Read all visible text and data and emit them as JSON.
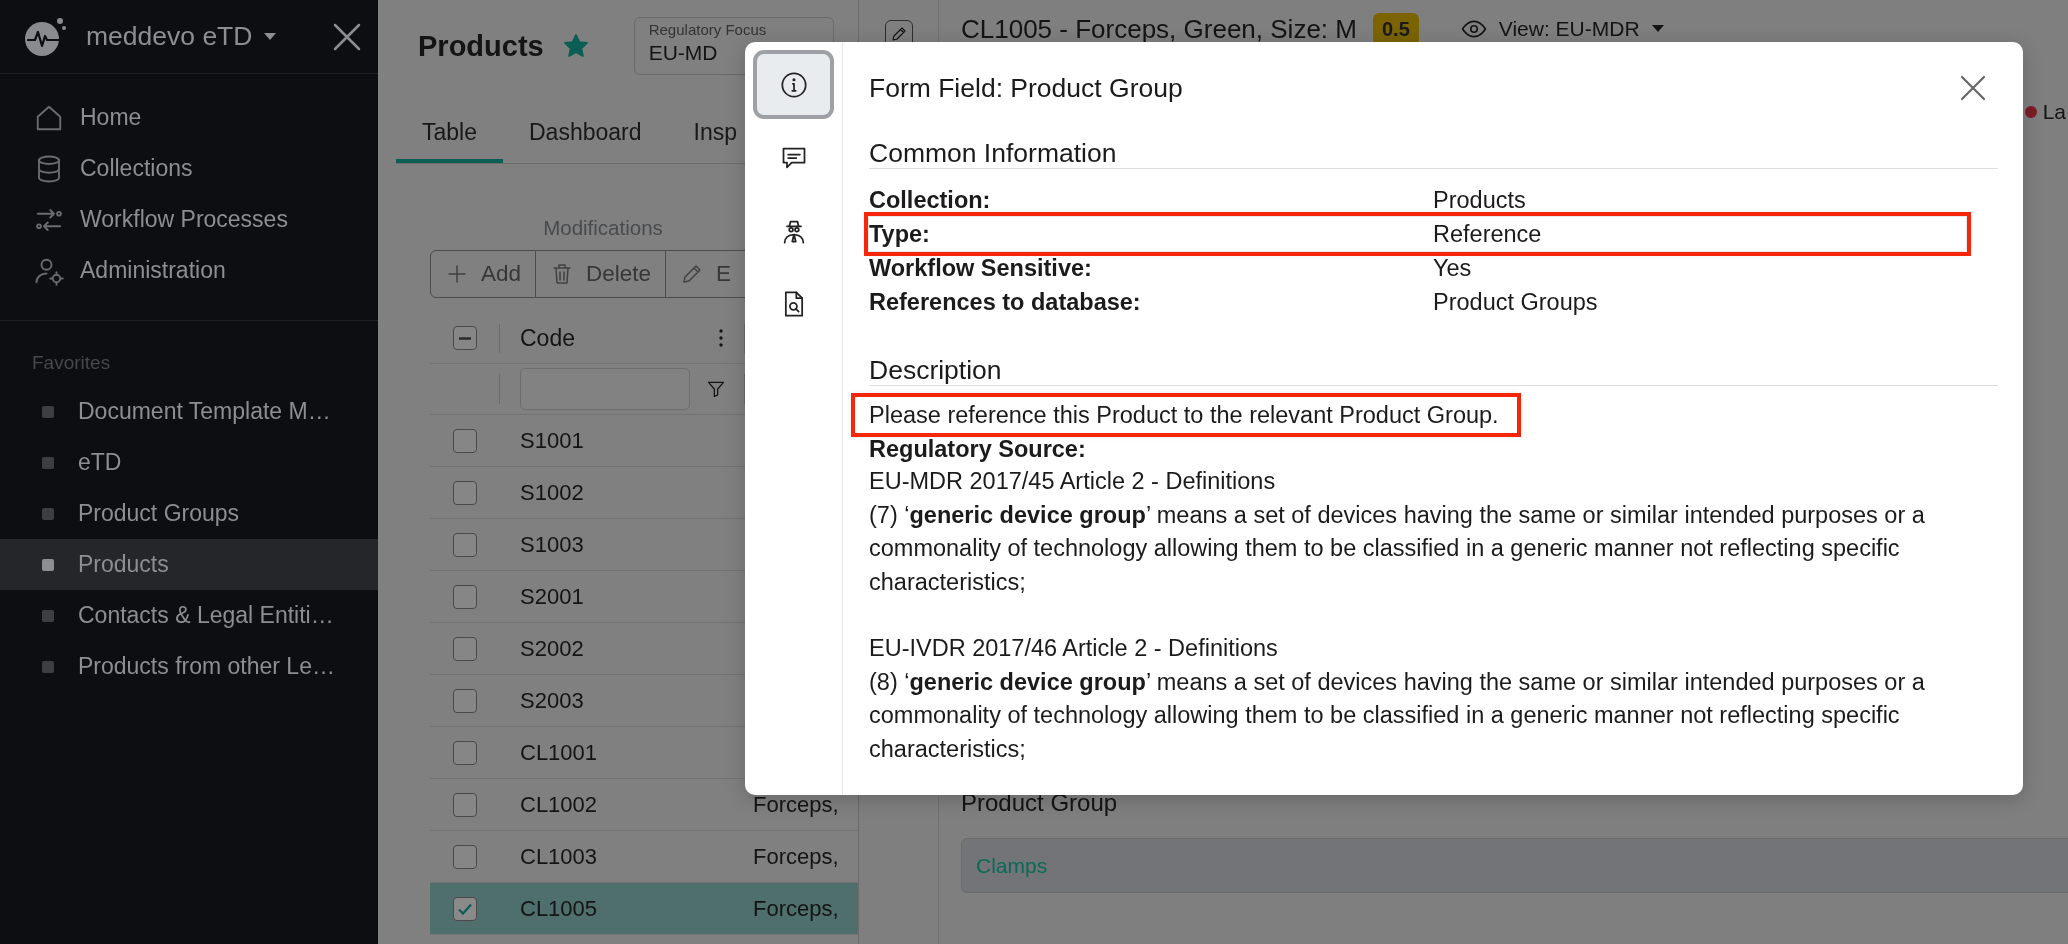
{
  "sidebar": {
    "brand": "meddevo eTD",
    "nav": [
      {
        "label": "Home"
      },
      {
        "label": "Collections"
      },
      {
        "label": "Workflow Processes"
      },
      {
        "label": "Administration"
      }
    ],
    "favorites_heading": "Favorites",
    "favorites": [
      {
        "label": "Document Template M…",
        "selected": false
      },
      {
        "label": "eTD",
        "selected": false
      },
      {
        "label": "Product Groups",
        "selected": false
      },
      {
        "label": "Products",
        "selected": true
      },
      {
        "label": "Contacts & Legal Entiti…",
        "selected": false
      },
      {
        "label": "Products from other Le…",
        "selected": false
      }
    ]
  },
  "page": {
    "title": "Products",
    "favorite": true,
    "focus_label": "Regulatory Focus",
    "focus_value": "EU-MD",
    "tabs": [
      {
        "label": "Table",
        "selected": true
      },
      {
        "label": "Dashboard",
        "selected": false
      },
      {
        "label": "Insp",
        "selected": false
      }
    ],
    "toolbar_label": "Modifications",
    "toolbar": [
      {
        "label": "Add"
      },
      {
        "label": "Delete"
      },
      {
        "label": "E"
      }
    ]
  },
  "table": {
    "select_all_partial": true,
    "columns": [
      "Code"
    ],
    "rows": [
      {
        "code": "S1001",
        "checked": false,
        "selected": false
      },
      {
        "code": "S1002",
        "checked": false,
        "selected": false
      },
      {
        "code": "S1003",
        "checked": false,
        "selected": false
      },
      {
        "code": "S2001",
        "checked": false,
        "selected": false
      },
      {
        "code": "S2002",
        "checked": false,
        "selected": false
      },
      {
        "code": "S2003",
        "checked": false,
        "selected": false
      },
      {
        "code": "CL1001",
        "checked": false,
        "selected": false
      },
      {
        "code": "CL1002",
        "column_2": "Forceps,",
        "checked": false,
        "selected": false
      },
      {
        "code": "CL1003",
        "column_2": "Forceps,",
        "checked": false,
        "selected": false
      },
      {
        "code": "CL1005",
        "column_2": "Forceps,",
        "checked": true,
        "selected": true
      }
    ]
  },
  "detail": {
    "title": "CL1005 - Forceps, Green, Size: M",
    "badge": "0.5",
    "view": "View: EU-MDR",
    "status": "La",
    "fields": [
      {
        "label": "Product Group",
        "value": "Clamps"
      }
    ]
  },
  "modal": {
    "rail": [
      {
        "selected": true
      },
      {
        "selected": false
      },
      {
        "selected": false
      },
      {
        "selected": false
      }
    ],
    "title": "Form Field: Product Group",
    "common_heading": "Common Information",
    "properties": [
      {
        "label": "Collection:",
        "value": "Products",
        "highlighted": false
      },
      {
        "label": "Type:",
        "value": "Reference",
        "highlighted": true
      },
      {
        "label": "Workflow Sensitive:",
        "value": "Yes",
        "highlighted": false
      },
      {
        "label": "References to database:",
        "value": "Product Groups",
        "highlighted": false
      }
    ],
    "description_heading": "Description",
    "description": {
      "text": "Please reference this Product to the relevant Product Group.",
      "highlighted": true
    },
    "source_label": "Regulatory Source:",
    "sources": [
      {
        "title": "EU-MDR 2017/45 Article 2 - Definitions",
        "text": "(7) ‘**generic device group**’ means a set of devices having the same or similar intended purposes or a commonality of technology allowing them to be classified in a generic manner not reflecting specific characteristics;"
      },
      {
        "title": "EU-IVDR 2017/46 Article 2 - Definitions",
        "text": "(8) ‘**generic device group**’ means a set of devices having the same or similar intended purposes or a commonality of technology allowing them to be classified in a generic manner not reflecting specific characteristics;"
      }
    ]
  }
}
